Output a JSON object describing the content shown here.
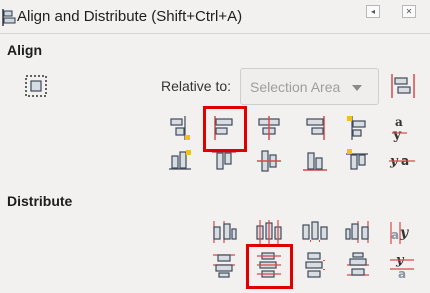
{
  "window": {
    "title": "Align and Distribute (Shift+Ctrl+A)",
    "dock_button_glyph": "◂",
    "close_button_glyph": "✕"
  },
  "align": {
    "section_label": "Align",
    "relative_to_label": "Relative to:",
    "relative_to_value": "Selection Area",
    "row1_icons": [
      "align-right-edges-to-left-icon",
      "align-left-edges-icon",
      "center-on-vertical-axis-icon",
      "align-right-edges-icon",
      "align-left-edges-to-right-icon",
      "align-baseline-text-horizontal-icon"
    ],
    "row2_icons": [
      "align-bottom-to-top-icon",
      "align-top-edges-icon",
      "center-on-horizontal-axis-icon",
      "align-bottom-edges-icon",
      "align-top-to-bottom-icon",
      "align-baseline-text-vertical-icon"
    ]
  },
  "distribute": {
    "section_label": "Distribute",
    "row1_icons": [
      "distribute-left-edges-icon",
      "distribute-centers-horizontal-icon",
      "distribute-gaps-horizontal-icon",
      "distribute-right-edges-icon",
      "distribute-anchors-horizontal-icon"
    ],
    "row2_icons": [
      "distribute-top-edges-icon",
      "distribute-centers-vertical-icon",
      "distribute-gaps-vertical-icon",
      "distribute-bottom-edges-icon",
      "distribute-anchors-vertical-icon"
    ]
  },
  "colors": {
    "panel_bg": "#f2f1f0",
    "icon_fill": "#d9dde2",
    "icon_stroke": "#3d4a5a",
    "guide_red": "#d84a4a",
    "accent_yellow": "#f0c020",
    "highlight_red": "#e00000"
  }
}
